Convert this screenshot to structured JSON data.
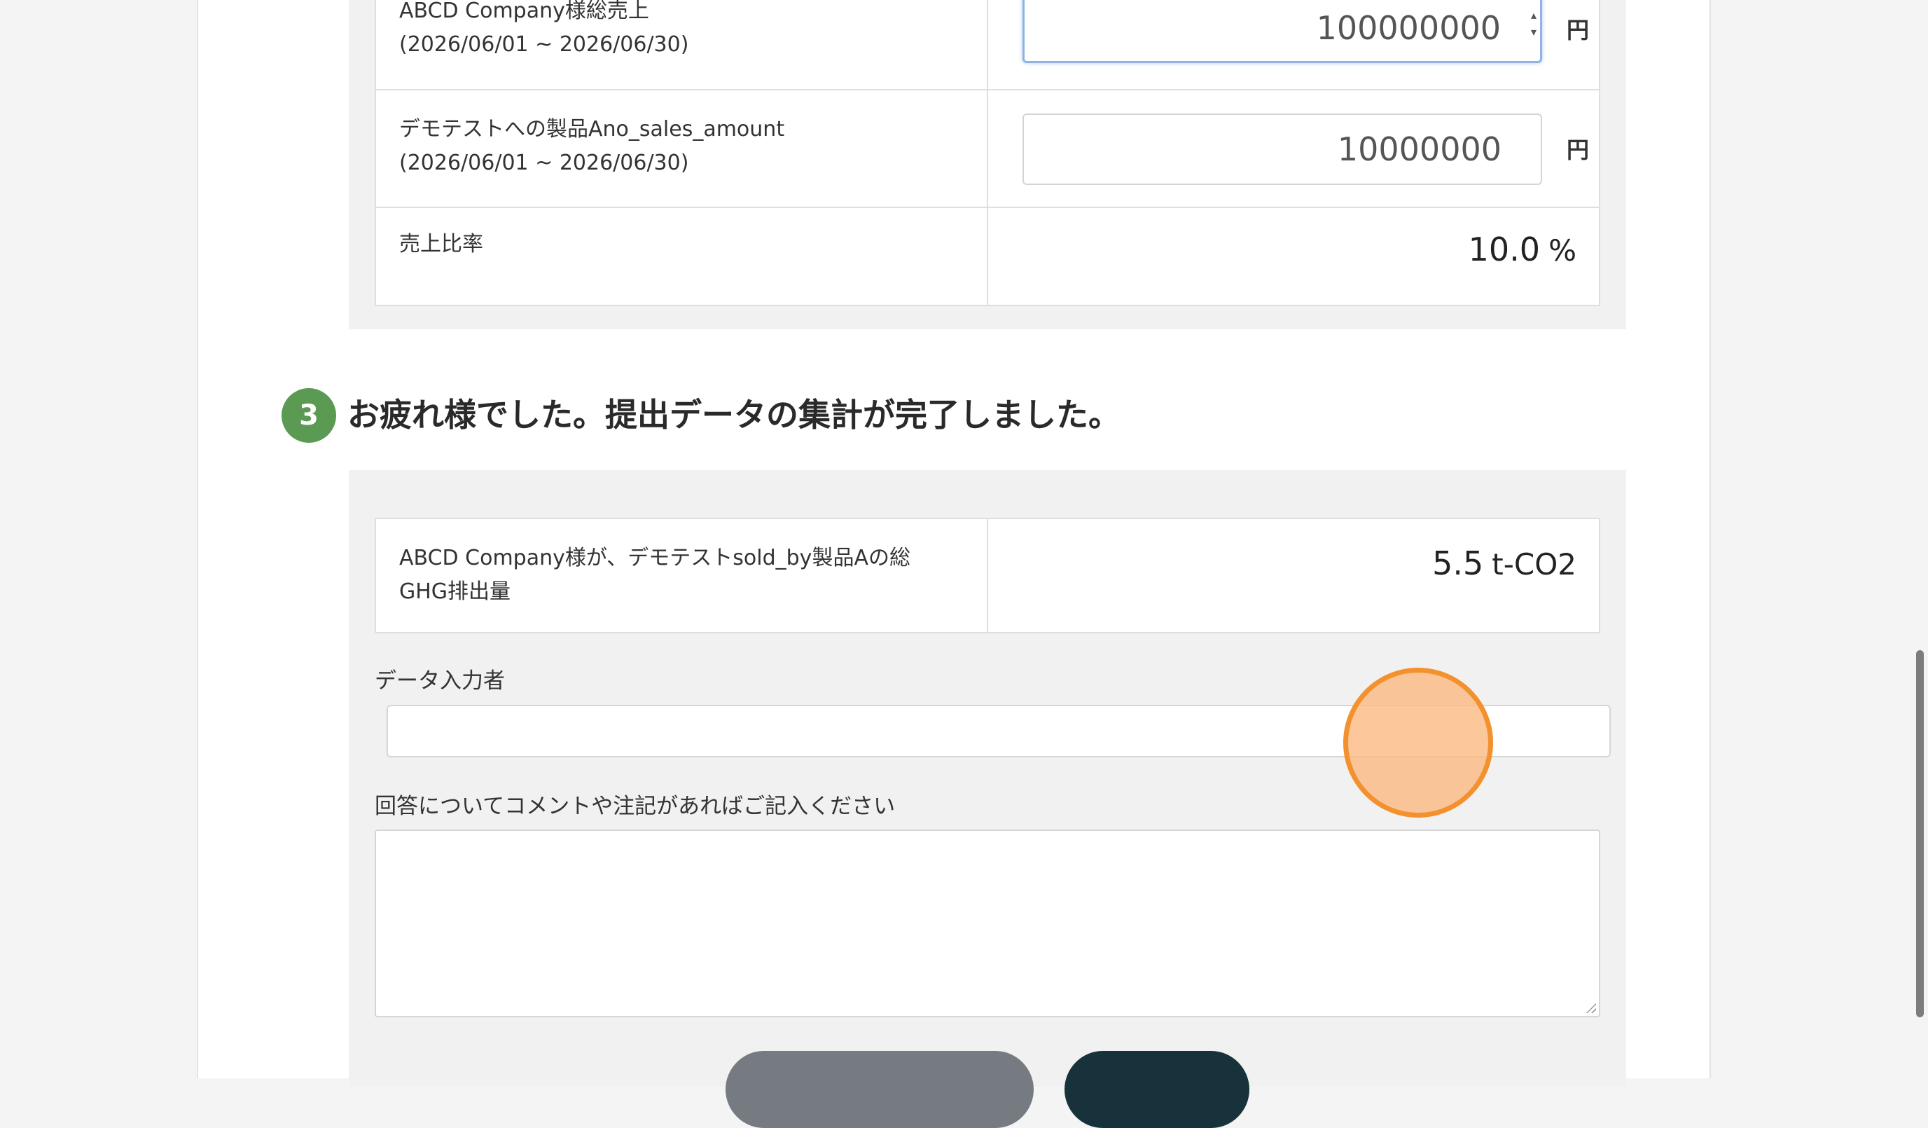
{
  "sales_table": {
    "rows": [
      {
        "label_line1": "ABCD Company様総売上",
        "label_line2": "(2026/06/01 ~ 2026/06/30)",
        "value": "100000000",
        "unit": "円"
      },
      {
        "label_line1": "デモテストへの製品Ano_sales_amount",
        "label_line2": "(2026/06/01 ~ 2026/06/30)",
        "value": "10000000",
        "unit": "円"
      }
    ],
    "ratio": {
      "label": "売上比率",
      "value": "10.0",
      "unit": "%"
    }
  },
  "step3": {
    "number": "3",
    "title": "お疲れ様でした。提出データの集計が完了しました。"
  },
  "ghg": {
    "label_line1": "ABCD Company様が、デモテストsold_by製品Aの総",
    "label_line2": "GHG排出量",
    "value": "5.5",
    "unit": "t-CO2"
  },
  "form": {
    "data_entry_label": "データ入力者",
    "data_entry_value": "",
    "comment_label": "回答についてコメントや注記があればご記入ください",
    "comment_value": ""
  },
  "colors": {
    "step_badge": "#5a9a52",
    "back_button": "#757b80",
    "submit_button": "#17323a",
    "click_marker": "#f4912f"
  }
}
